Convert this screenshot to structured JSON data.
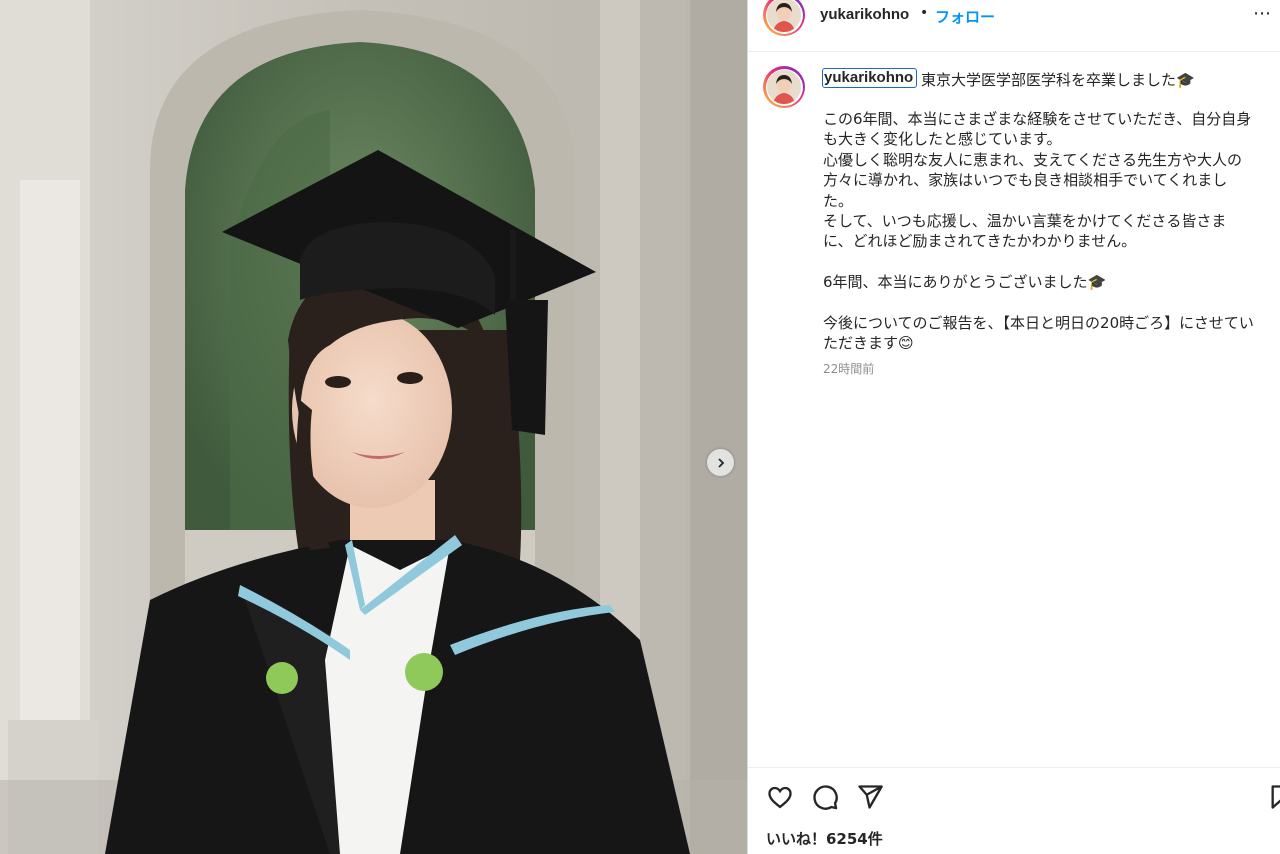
{
  "post": {
    "username": "yukarikohno",
    "separator": "•",
    "follow_label": "フォロー",
    "more_label": "⋯",
    "caption": {
      "username": "yukarikohno",
      "title": "東京大学医学部医学科を卒業しました🎓",
      "lines": [
        "この6年間、本当にさまざまな経験をさせていただき、自分自身",
        "も大きく変化したと感じています。",
        "心優しく聡明な友人に恵まれ、支えてくださる先生方や大人の",
        "方々に導かれ、家族はいつでも良き相談相手でいてくれまし",
        "た。",
        "そして、いつも応援し、温かい言葉をかけてくださる皆さま",
        "に、どれほど励まされてきたかわかりません。",
        "",
        "6年間、本当にありがとうございました🎓",
        "",
        "今後についてのご報告を、【本日と明日の20時ごろ】にさせてい",
        "ただきます😊"
      ],
      "timestamp": "22時間前"
    },
    "likes": "いいね！6254件"
  },
  "icons": {
    "next": "chevron-right-icon",
    "like": "heart-icon",
    "comment": "comment-bubble-icon",
    "share": "paper-plane-icon",
    "save": "bookmark-icon",
    "more": "more-horizontal-icon"
  },
  "colors": {
    "link": "#0095f6",
    "text": "#262626",
    "muted": "#8e8e8e",
    "focus_outline": "#1a66d6"
  }
}
